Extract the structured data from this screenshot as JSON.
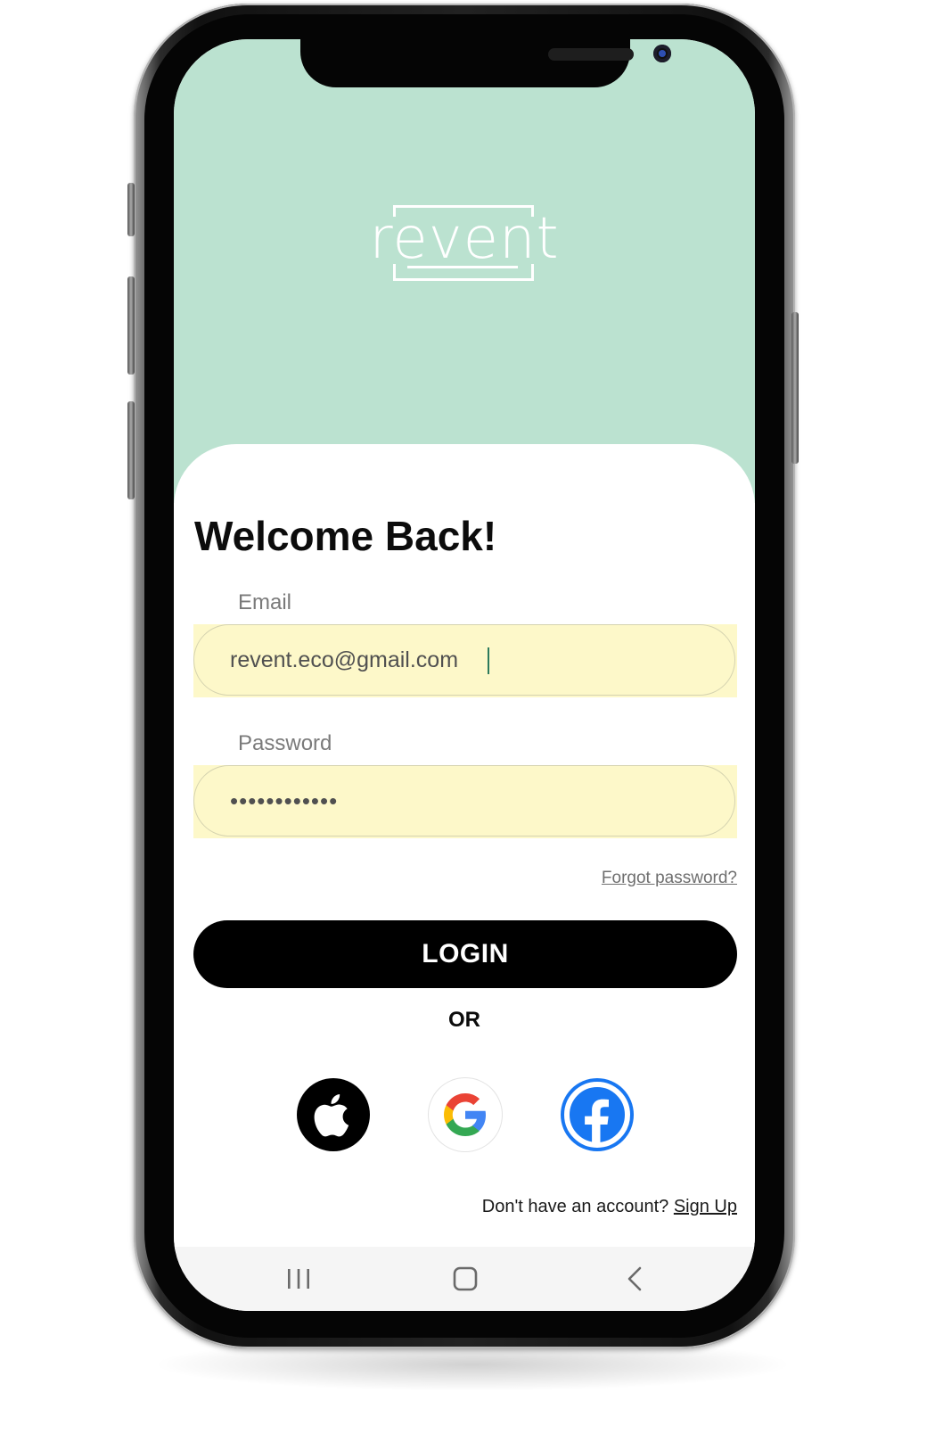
{
  "header": {
    "logo_text": "revent",
    "background_color": "#bbe2d0"
  },
  "login": {
    "title": "Welcome Back!",
    "email": {
      "label": "Email",
      "value": "revent.eco@gmail.com"
    },
    "password": {
      "label": "Password",
      "masked_value": "••••••••••••"
    },
    "forgot_password": "Forgot password?",
    "login_button": "LOGIN",
    "divider": "OR",
    "social_logins": [
      {
        "icon": "apple-icon"
      },
      {
        "icon": "google-icon"
      },
      {
        "icon": "facebook-icon"
      }
    ],
    "signup_prompt": "Don't have an account?",
    "signup_link": "Sign Up"
  },
  "system_nav": {
    "icons": [
      "recent-apps-icon",
      "home-icon",
      "back-icon"
    ]
  },
  "colors": {
    "accent_mint": "#bbe2d0",
    "autofill_yellow": "#fdf8c9",
    "button_black": "#000000",
    "facebook_blue": "#1877f2"
  }
}
